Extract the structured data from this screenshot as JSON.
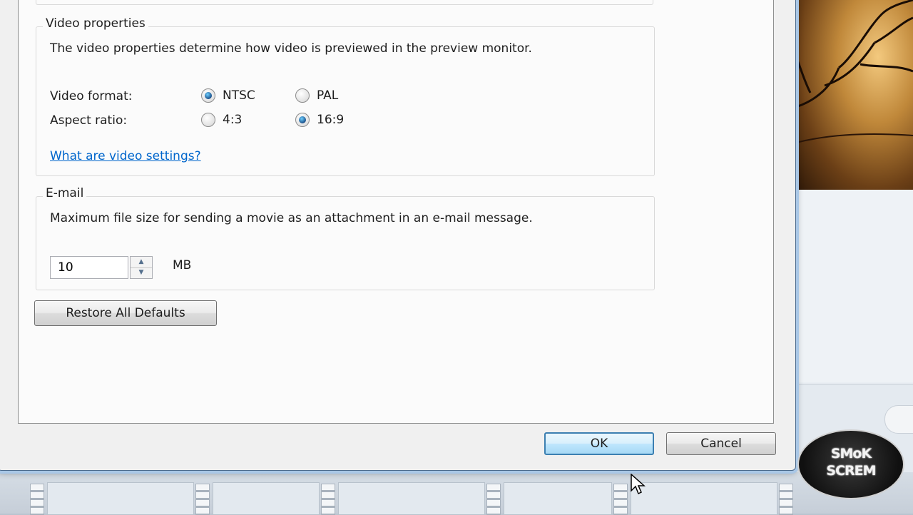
{
  "video_properties": {
    "title": "Video properties",
    "description": "The video properties determine how video is previewed in the preview monitor.",
    "format_label": "Video format:",
    "format_options": [
      {
        "label": "NTSC",
        "selected": true
      },
      {
        "label": "PAL",
        "selected": false
      }
    ],
    "aspect_label": "Aspect ratio:",
    "aspect_options": [
      {
        "label": "4:3",
        "selected": false
      },
      {
        "label": "16:9",
        "selected": true
      }
    ],
    "help_link": "What are video settings?"
  },
  "email": {
    "title": "E-mail",
    "description": "Maximum file size for sending a movie as an attachment in an e-mail message.",
    "size_value": "10",
    "size_unit": "MB"
  },
  "restore_button": "Restore All Defaults",
  "ok_button": "OK",
  "cancel_button": "Cancel",
  "watermark": {
    "line1": "SMoK",
    "line2": "SCREM"
  },
  "colors": {
    "link": "#0066cc",
    "window_frame": "#a9c7e6",
    "default_button_border": "#3c7fb1"
  }
}
